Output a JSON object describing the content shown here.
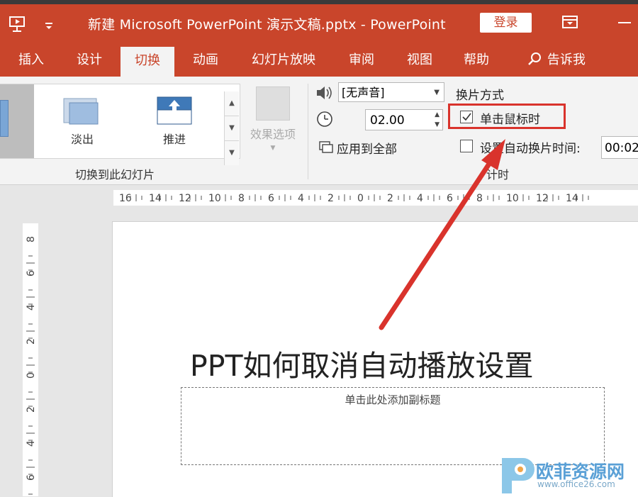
{
  "titlebar": {
    "doc_title": "新建 Microsoft PowerPoint 演示文稿.pptx  -  PowerPoint",
    "login_label": "登录",
    "accent_color": "#c9452b",
    "icons": [
      "slideshow-start-icon",
      "quick-access-dropdown-icon",
      "ribbon-display-options-icon",
      "minimize-icon"
    ]
  },
  "tabs": [
    {
      "label": "插入"
    },
    {
      "label": "设计"
    },
    {
      "label": "切换",
      "active": true
    },
    {
      "label": "动画"
    },
    {
      "label": "幻灯片放映"
    },
    {
      "label": "审阅"
    },
    {
      "label": "视图"
    },
    {
      "label": "帮助"
    },
    {
      "label": "告诉我"
    }
  ],
  "ribbon": {
    "transitions": [
      {
        "label": "淡出"
      },
      {
        "label": "推进"
      }
    ],
    "effect_options_label": "效果选项",
    "group_switch_label": "切换到此幻灯片",
    "sound_value": "[无声音]",
    "duration_value": "02.00",
    "apply_all_label": "应用到全部",
    "advance_title": "换片方式",
    "on_click_label": "单击鼠标时",
    "on_click_checked": true,
    "auto_advance_label": "设置自动换片时间:",
    "auto_advance_checked": false,
    "auto_advance_value": "00:02",
    "timing_group_label": "计时",
    "highlight_color": "#d9332c"
  },
  "ruler": {
    "horizontal_labels": [
      "16",
      "14",
      "12",
      "10",
      "8",
      "6",
      "4",
      "2",
      "0",
      "2",
      "4",
      "6",
      "8",
      "10",
      "12",
      "14"
    ],
    "vertical_labels": [
      "8",
      "6",
      "4",
      "2",
      "0",
      "2",
      "4",
      "6"
    ]
  },
  "slide": {
    "title": "PPT如何取消自动播放设置",
    "subtitle_placeholder": "单击此处添加副标题"
  },
  "watermark": {
    "name": "欧菲资源网",
    "url": "www.office26.com"
  }
}
